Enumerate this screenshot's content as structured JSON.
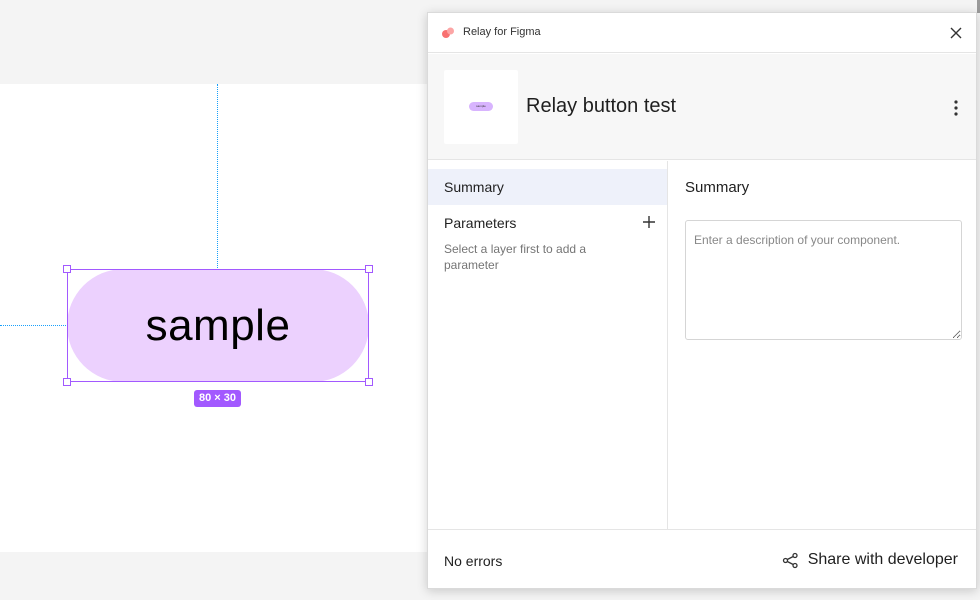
{
  "canvas": {
    "component_text": "sample",
    "size_badge": "80 × 30",
    "fill_color": "#ecd1fe",
    "selection_color": "#a259ff",
    "guide_color": "#18a0fb"
  },
  "plugin": {
    "title": "Relay for Figma",
    "logo_icon": "relay-logo-icon",
    "close_icon": "close-icon"
  },
  "component": {
    "name": "Relay button test",
    "thumbnail_label": "sample",
    "menu_icon": "more-vertical-icon"
  },
  "sidebar": {
    "items": [
      {
        "label": "Summary",
        "active": true
      }
    ],
    "parameters": {
      "label": "Parameters",
      "add_icon": "plus-icon",
      "hint": "Select a layer first to add a parameter"
    }
  },
  "summary": {
    "heading": "Summary",
    "description_placeholder": "Enter a description of your component.",
    "description_value": ""
  },
  "footer": {
    "status": "No errors",
    "share_label": "Share with developer",
    "share_icon": "share-icon"
  }
}
